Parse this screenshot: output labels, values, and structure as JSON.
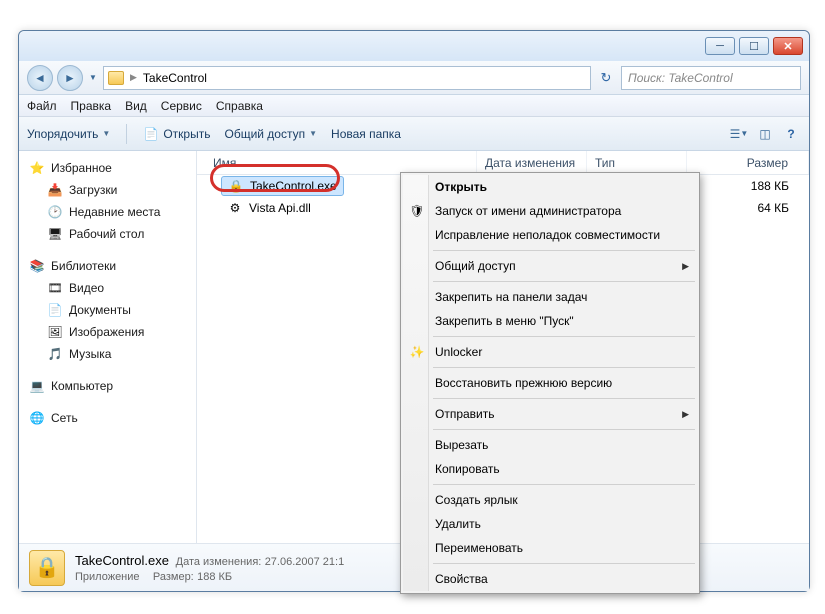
{
  "address": {
    "folder": "TakeControl"
  },
  "search": {
    "placeholder": "Поиск: TakeControl"
  },
  "menu": {
    "file": "Файл",
    "edit": "Правка",
    "view": "Вид",
    "tools": "Сервис",
    "help": "Справка"
  },
  "toolbar": {
    "organize": "Упорядочить",
    "open": "Открыть",
    "share": "Общий доступ",
    "newfolder": "Новая папка"
  },
  "columns": {
    "name": "Имя",
    "date": "Дата изменения",
    "type": "Тип",
    "size": "Размер"
  },
  "sidebar": {
    "favorites": {
      "label": "Избранное",
      "items": [
        {
          "label": "Загрузки",
          "icon": "📥"
        },
        {
          "label": "Недавние места",
          "icon": "🕑"
        },
        {
          "label": "Рабочий стол",
          "icon": "🖥"
        }
      ]
    },
    "libraries": {
      "label": "Библиотеки",
      "items": [
        {
          "label": "Видео",
          "icon": "🎞"
        },
        {
          "label": "Документы",
          "icon": "📄"
        },
        {
          "label": "Изображения",
          "icon": "🖼"
        },
        {
          "label": "Музыка",
          "icon": "🎵"
        }
      ]
    },
    "computer": {
      "label": "Компьютер"
    },
    "network": {
      "label": "Сеть"
    }
  },
  "files": [
    {
      "name": "TakeControl.exe",
      "size": "188 КБ",
      "icon": "🔒"
    },
    {
      "name": "Vista Api.dll",
      "size": "64 КБ",
      "icon": "⚙"
    }
  ],
  "context": {
    "open": "Открыть",
    "runas": "Запуск от имени администратора",
    "troubleshoot": "Исправление неполадок совместимости",
    "share": "Общий доступ",
    "pin_taskbar": "Закрепить на панели задач",
    "pin_start": "Закрепить в меню \"Пуск\"",
    "unlocker": "Unlocker",
    "restore": "Восстановить прежнюю версию",
    "sendto": "Отправить",
    "cut": "Вырезать",
    "copy": "Копировать",
    "shortcut": "Создать ярлык",
    "delete": "Удалить",
    "rename": "Переименовать",
    "properties": "Свойства"
  },
  "status": {
    "filename": "TakeControl.exe",
    "date_label": "Дата изменения:",
    "date": "27.06.2007 21:1",
    "type": "Приложение",
    "size_label": "Размер:",
    "size": "188 КБ"
  }
}
